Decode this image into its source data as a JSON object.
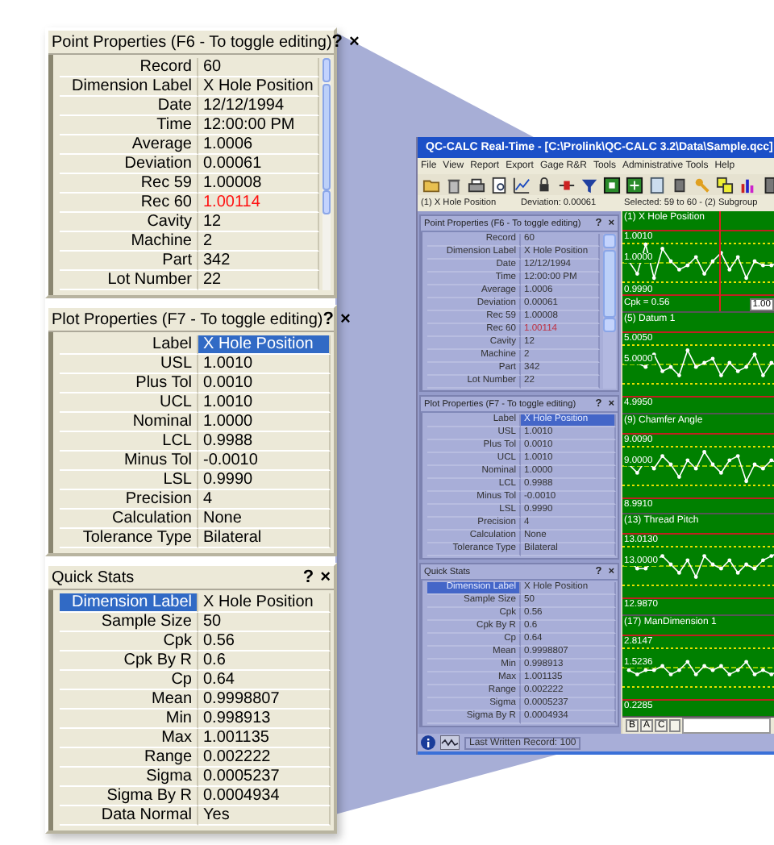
{
  "zoom_panels": [
    {
      "title": "Point Properties (F6 - To toggle editing)",
      "help": "?",
      "close": "×",
      "kind": "properties",
      "scrollbar": true,
      "rows": [
        {
          "label": "Record",
          "value": "60",
          "selected": false,
          "flagged": false
        },
        {
          "label": "Dimension Label",
          "value": "X Hole Position",
          "selected": false,
          "flagged": false
        },
        {
          "label": "Date",
          "value": "12/12/1994",
          "selected": false,
          "flagged": false
        },
        {
          "label": "Time",
          "value": "12:00:00 PM",
          "selected": false,
          "flagged": false
        },
        {
          "label": "Average",
          "value": "1.0006",
          "selected": false,
          "flagged": false
        },
        {
          "label": "Deviation",
          "value": "0.00061",
          "selected": false,
          "flagged": false
        },
        {
          "label": "Rec 59",
          "value": "1.00008",
          "selected": false,
          "flagged": false
        },
        {
          "label": "Rec 60",
          "value": "1.00114",
          "selected": false,
          "flagged": true
        },
        {
          "label": "Cavity",
          "value": "12",
          "selected": false,
          "flagged": false
        },
        {
          "label": "Machine",
          "value": "2",
          "selected": false,
          "flagged": false
        },
        {
          "label": "Part",
          "value": "342",
          "selected": false,
          "flagged": false
        },
        {
          "label": "Lot Number",
          "value": "22",
          "selected": false,
          "flagged": false
        }
      ]
    },
    {
      "title": "Plot Properties (F7 - To toggle editing)",
      "help": "?",
      "close": "×",
      "kind": "properties",
      "scrollbar": false,
      "rows": [
        {
          "label": "Label",
          "value": "X Hole Position",
          "selected": true,
          "flagged": false
        },
        {
          "label": "USL",
          "value": "1.0010",
          "selected": false,
          "flagged": false
        },
        {
          "label": "Plus Tol",
          "value": "0.0010",
          "selected": false,
          "flagged": false
        },
        {
          "label": "UCL",
          "value": "1.0010",
          "selected": false,
          "flagged": false
        },
        {
          "label": "Nominal",
          "value": "1.0000",
          "selected": false,
          "flagged": false
        },
        {
          "label": "LCL",
          "value": "0.9988",
          "selected": false,
          "flagged": false
        },
        {
          "label": "Minus Tol",
          "value": "-0.0010",
          "selected": false,
          "flagged": false
        },
        {
          "label": "LSL",
          "value": "0.9990",
          "selected": false,
          "flagged": false
        },
        {
          "label": "Precision",
          "value": "4",
          "selected": false,
          "flagged": false
        },
        {
          "label": "Calculation",
          "value": "None",
          "selected": false,
          "flagged": false
        },
        {
          "label": "Tolerance Type",
          "value": "Bilateral",
          "selected": false,
          "flagged": false
        }
      ]
    },
    {
      "title": "Quick Stats",
      "help": "?",
      "close": "×",
      "kind": "stats",
      "scrollbar": false,
      "rows": [
        {
          "label": "Dimension Label",
          "value": "X Hole Position",
          "selected": true,
          "flagged": false
        },
        {
          "label": "Sample Size",
          "value": "50",
          "selected": false,
          "flagged": false
        },
        {
          "label": "Cpk",
          "value": "0.56",
          "selected": false,
          "flagged": false
        },
        {
          "label": "Cpk By R",
          "value": "0.6",
          "selected": false,
          "flagged": false
        },
        {
          "label": "Cp",
          "value": "0.64",
          "selected": false,
          "flagged": false
        },
        {
          "label": "Mean",
          "value": "0.9998807",
          "selected": false,
          "flagged": false
        },
        {
          "label": "Min",
          "value": "0.998913",
          "selected": false,
          "flagged": false
        },
        {
          "label": "Max",
          "value": "1.001135",
          "selected": false,
          "flagged": false
        },
        {
          "label": "Range",
          "value": "0.002222",
          "selected": false,
          "flagged": false
        },
        {
          "label": "Sigma",
          "value": "0.0005237",
          "selected": false,
          "flagged": false
        },
        {
          "label": "Sigma By R",
          "value": "0.0004934",
          "selected": false,
          "flagged": false
        },
        {
          "label": "Data Normal",
          "value": "Yes",
          "selected": false,
          "flagged": false
        }
      ]
    }
  ],
  "app_window": {
    "title": "QC-CALC Real-Time - [C:\\Prolink\\QC-CALC 3.2\\Data\\Sample.qcc]",
    "menu": [
      "File",
      "View",
      "Report",
      "Export",
      "Gage R&R",
      "Tools",
      "Administrative Tools",
      "Help"
    ],
    "info_bar": {
      "dimension": "(1) X Hole Position",
      "deviation": "Deviation: 0.00061",
      "selection": "Selected: 59 to 60 - (2)  Subgroup"
    },
    "panels": [
      {
        "title": "Point Properties (F6 - To toggle editing)",
        "help": "?",
        "close": "×",
        "kind": "properties",
        "scrollbar": true,
        "rows": [
          {
            "label": "Record",
            "value": "60",
            "selected": false,
            "flagged": false
          },
          {
            "label": "Dimension Label",
            "value": "X Hole Position",
            "selected": false,
            "flagged": false
          },
          {
            "label": "Date",
            "value": "12/12/1994",
            "selected": false,
            "flagged": false
          },
          {
            "label": "Time",
            "value": "12:00:00 PM",
            "selected": false,
            "flagged": false
          },
          {
            "label": "Average",
            "value": "1.0006",
            "selected": false,
            "flagged": false
          },
          {
            "label": "Deviation",
            "value": "0.00061",
            "selected": false,
            "flagged": false
          },
          {
            "label": "Rec 59",
            "value": "1.00008",
            "selected": false,
            "flagged": false
          },
          {
            "label": "Rec 60",
            "value": "1.00114",
            "selected": false,
            "flagged": true
          },
          {
            "label": "Cavity",
            "value": "12",
            "selected": false,
            "flagged": false
          },
          {
            "label": "Machine",
            "value": "2",
            "selected": false,
            "flagged": false
          },
          {
            "label": "Part",
            "value": "342",
            "selected": false,
            "flagged": false
          },
          {
            "label": "Lot Number",
            "value": "22",
            "selected": false,
            "flagged": false
          }
        ]
      },
      {
        "title": "Plot Properties (F7 - To toggle editing)",
        "help": "?",
        "close": "×",
        "kind": "properties",
        "scrollbar": false,
        "rows": [
          {
            "label": "Label",
            "value": "X Hole Position",
            "selected": true,
            "flagged": false
          },
          {
            "label": "USL",
            "value": "1.0010",
            "selected": false,
            "flagged": false
          },
          {
            "label": "Plus Tol",
            "value": "0.0010",
            "selected": false,
            "flagged": false
          },
          {
            "label": "UCL",
            "value": "1.0010",
            "selected": false,
            "flagged": false
          },
          {
            "label": "Nominal",
            "value": "1.0000",
            "selected": false,
            "flagged": false
          },
          {
            "label": "LCL",
            "value": "0.9988",
            "selected": false,
            "flagged": false
          },
          {
            "label": "Minus Tol",
            "value": "-0.0010",
            "selected": false,
            "flagged": false
          },
          {
            "label": "LSL",
            "value": "0.9990",
            "selected": false,
            "flagged": false
          },
          {
            "label": "Precision",
            "value": "4",
            "selected": false,
            "flagged": false
          },
          {
            "label": "Calculation",
            "value": "None",
            "selected": false,
            "flagged": false
          },
          {
            "label": "Tolerance Type",
            "value": "Bilateral",
            "selected": false,
            "flagged": false
          }
        ]
      },
      {
        "title": "Quick Stats",
        "help": "?",
        "close": "×",
        "kind": "stats",
        "scrollbar": false,
        "rows": [
          {
            "label": "Dimension Label",
            "value": "X Hole Position",
            "selected": true,
            "flagged": false
          },
          {
            "label": "Sample Size",
            "value": "50",
            "selected": false,
            "flagged": false
          },
          {
            "label": "Cpk",
            "value": "0.56",
            "selected": false,
            "flagged": false
          },
          {
            "label": "Cpk By R",
            "value": "0.6",
            "selected": false,
            "flagged": false
          },
          {
            "label": "Cp",
            "value": "0.64",
            "selected": false,
            "flagged": false
          },
          {
            "label": "Mean",
            "value": "0.9998807",
            "selected": false,
            "flagged": false
          },
          {
            "label": "Min",
            "value": "0.998913",
            "selected": false,
            "flagged": false
          },
          {
            "label": "Max",
            "value": "1.001135",
            "selected": false,
            "flagged": false
          },
          {
            "label": "Range",
            "value": "0.002222",
            "selected": false,
            "flagged": false
          },
          {
            "label": "Sigma",
            "value": "0.0005237",
            "selected": false,
            "flagged": false
          },
          {
            "label": "Sigma By R",
            "value": "0.0004934",
            "selected": false,
            "flagged": false
          }
        ]
      }
    ],
    "charts": [
      {
        "title": "(1) X Hole Position",
        "upper": "1.0010",
        "center": "1.0000",
        "lower": "0.9990",
        "note": "Cpk = 0.56",
        "value_box": "1.00",
        "cursor": true
      },
      {
        "title": "(5) Datum 1",
        "upper": "5.0050",
        "center": "5.0000",
        "lower": "4.9950",
        "cursor": false
      },
      {
        "title": "(9) Chamfer Angle",
        "upper": "9.0090",
        "center": "9.0000",
        "lower": "8.9910",
        "cursor": false
      },
      {
        "title": "(13) Thread Pitch",
        "upper": "13.0130",
        "center": "13.0000",
        "lower": "12.9870",
        "cursor": false
      },
      {
        "title": "(17) ManDimension 1",
        "upper": "2.8147",
        "center": "1.5236",
        "lower": "0.2285",
        "cursor": false
      }
    ],
    "chart_tabs": [
      "B",
      "A",
      "C"
    ],
    "status_text": "Last Written Record: 100"
  }
}
